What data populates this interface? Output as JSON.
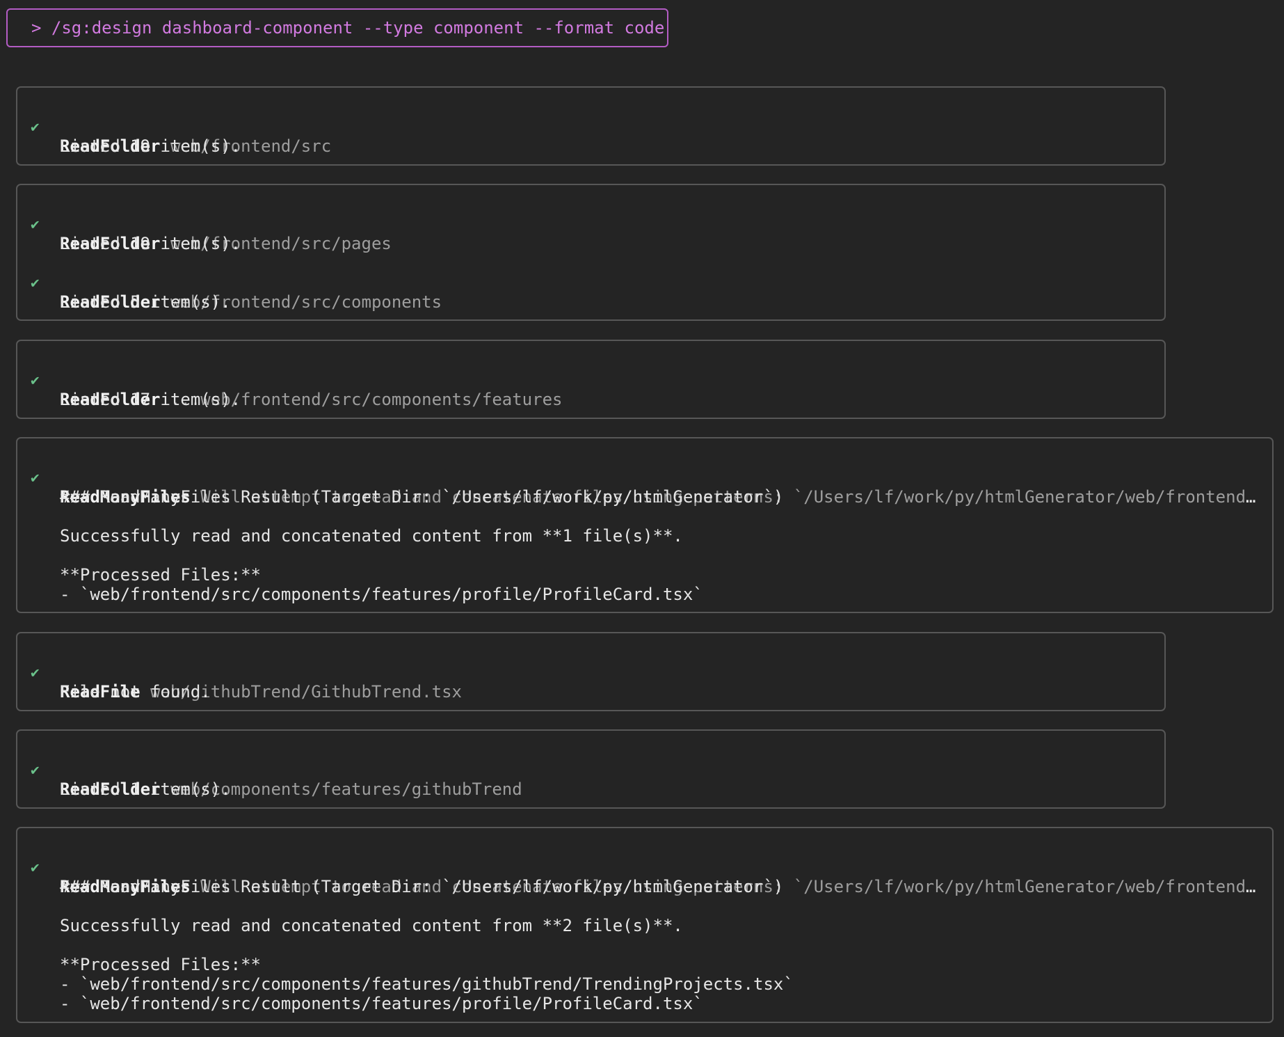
{
  "command": "> /sg:design dashboard-component --type component --format code",
  "blocks": [
    {
      "entries": [
        {
          "status": "✔",
          "tool": "ReadFolder",
          "desc": "web/frontend/src",
          "output": [
            "Listed 19 item(s)."
          ]
        }
      ]
    },
    {
      "entries": [
        {
          "status": "✔",
          "tool": "ReadFolder",
          "desc": "web/frontend/src/pages",
          "output": [
            "Listed 19 item(s)."
          ]
        },
        {
          "status": "✔",
          "tool": "ReadFolder",
          "desc": "web/frontend/src/components",
          "output": [
            "Listed 5 item(s)."
          ]
        }
      ]
    },
    {
      "entries": [
        {
          "status": "✔",
          "tool": "ReadFolder",
          "desc": "...web/frontend/src/components/features",
          "output": [
            "Listed 17 item(s)."
          ]
        }
      ]
    },
    {
      "entries": [
        {
          "status": "✔",
          "tool": "ReadManyFiles",
          "desc": "Will attempt to read and concatenate files using patterns: `/Users/lf/work/py/htmlGenerator/web/frontend/src…",
          "output": [
            "### ReadManyFiles Result (Target Dir: `/Users/lf/work/py/htmlGenerator`)",
            "Successfully read and concatenated content from **1 file(s)**.",
            "**Processed Files:**",
            "- `web/frontend/src/components/features/profile/ProfileCard.tsx`"
          ]
        }
      ]
    },
    {
      "entries": [
        {
          "status": "✔",
          "tool": "ReadFile",
          "desc": "web/githubTrend/GithubTrend.tsx",
          "output": [
            "File not found."
          ]
        }
      ]
    },
    {
      "entries": [
        {
          "status": "✔",
          "tool": "ReadFolder",
          "desc": "web/components/features/githubTrend",
          "output": [
            "Listed 1 item(s)."
          ]
        }
      ]
    },
    {
      "entries": [
        {
          "status": "✔",
          "tool": "ReadManyFiles",
          "desc": "Will attempt to read and concatenate files using patterns: `/Users/lf/work/py/htmlGenerator/web/frontend/src…",
          "output": [
            "### ReadManyFiles Result (Target Dir: `/Users/lf/work/py/htmlGenerator`)",
            "Successfully read and concatenated content from **2 file(s)**.",
            "**Processed Files:**",
            "- `web/frontend/src/components/features/githubTrend/TrendingProjects.tsx`",
            "- `web/frontend/src/components/features/profile/ProfileCard.tsx`"
          ]
        }
      ]
    }
  ]
}
